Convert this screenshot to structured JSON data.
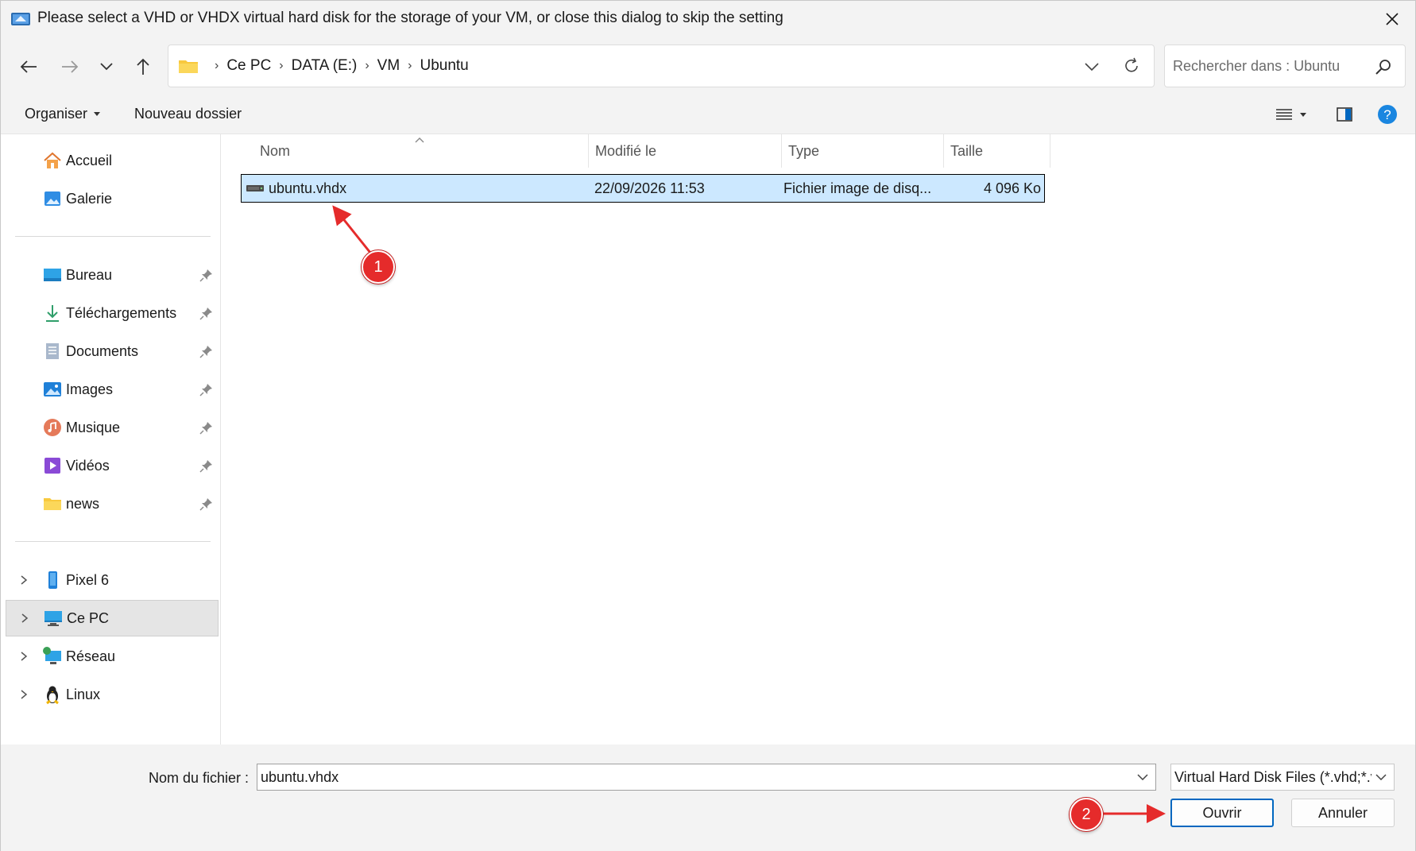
{
  "window": {
    "title": "Please select a VHD or VHDX virtual hard disk for the storage of your VM, or close this dialog to skip the setting"
  },
  "navbar": {
    "breadcrumbs": [
      "Ce PC",
      "DATA (E:)",
      "VM",
      "Ubuntu"
    ],
    "search_placeholder": "Rechercher dans : Ubuntu"
  },
  "commandbar": {
    "organize_label": "Organiser",
    "new_folder_label": "Nouveau dossier"
  },
  "sidebar": {
    "top_items": [
      {
        "label": "Accueil",
        "icon": "home-icon"
      },
      {
        "label": "Galerie",
        "icon": "gallery-icon"
      }
    ],
    "pinned_items": [
      {
        "label": "Bureau",
        "icon": "desktop-folder-icon"
      },
      {
        "label": "Téléchargements",
        "icon": "download-icon"
      },
      {
        "label": "Documents",
        "icon": "documents-icon"
      },
      {
        "label": "Images",
        "icon": "pictures-icon"
      },
      {
        "label": "Musique",
        "icon": "music-icon"
      },
      {
        "label": "Vidéos",
        "icon": "videos-icon"
      },
      {
        "label": "news",
        "icon": "folder-icon"
      }
    ],
    "device_items": [
      {
        "label": "Pixel 6",
        "icon": "phone-icon"
      },
      {
        "label": "Ce PC",
        "icon": "pc-icon",
        "selected": true
      },
      {
        "label": "Réseau",
        "icon": "network-icon"
      },
      {
        "label": "Linux",
        "icon": "linux-icon"
      }
    ]
  },
  "filelist": {
    "columns": [
      "Nom",
      "Modifié le",
      "Type",
      "Taille"
    ],
    "rows": [
      {
        "name": "ubuntu.vhdx",
        "modified": "22/09/2026 11:53",
        "type": "Fichier image de disq...",
        "size": "4 096 Ko",
        "selected": true
      }
    ]
  },
  "bottom": {
    "filename_label": "Nom du fichier :",
    "filename_value": "ubuntu.vhdx",
    "filter_value": "Virtual Hard Disk Files (*.vhd;*.vhdx)",
    "open_label": "Ouvrir",
    "cancel_label": "Annuler"
  },
  "annotations": {
    "step1": "1",
    "step2": "2",
    "color": "#e52b2b"
  },
  "colors": {
    "selection": "#cce8ff",
    "accent": "#0067c0",
    "chrome": "#f3f3f3"
  }
}
